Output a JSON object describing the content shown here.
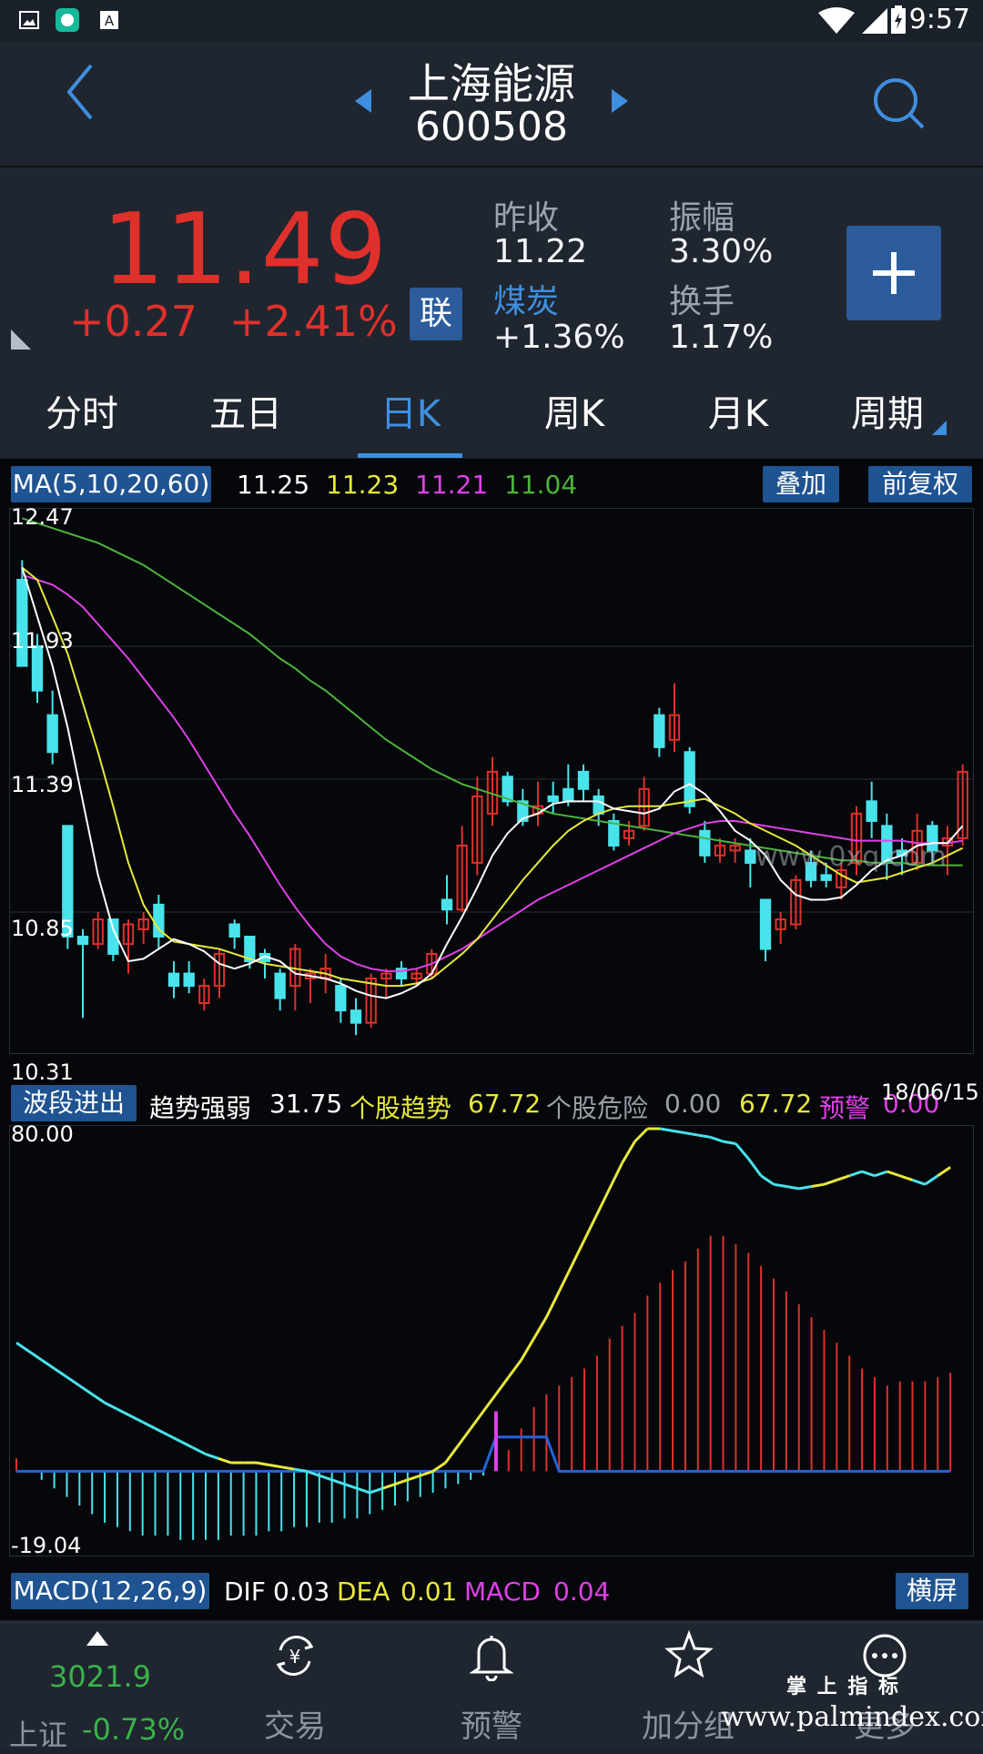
{
  "status_bar": {
    "time": "9:57"
  },
  "header": {
    "stock_name": "上海能源",
    "stock_code": "600508"
  },
  "quote": {
    "price": "11.49",
    "change": "+0.27",
    "change_pct": "+2.41%",
    "lian_label": "联",
    "prev_close_label": "昨收",
    "prev_close": "11.22",
    "amplitude_label": "振幅",
    "amplitude": "3.30%",
    "sector_label": "煤炭",
    "sector_change": "+1.36%",
    "turnover_label": "换手",
    "turnover": "1.17%"
  },
  "tabs": [
    {
      "label": "分时"
    },
    {
      "label": "五日"
    },
    {
      "label": "日K",
      "active": true
    },
    {
      "label": "周K"
    },
    {
      "label": "月K"
    },
    {
      "label": "周期"
    }
  ],
  "ma_bar": {
    "label": "MA(5,10,20,60)",
    "values": [
      "11.25",
      "11.23",
      "11.21",
      "11.04"
    ],
    "overlay_btn": "叠加",
    "adjust_btn": "前复权"
  },
  "kline": {
    "y_labels": [
      "12.47",
      "11.93",
      "11.39",
      "10.85",
      "10.31"
    ],
    "ymin": 10.31,
    "ymax": 12.47,
    "watermark": "www.0xq.com",
    "candles": [
      [
        12.2,
        12.28,
        11.85,
        11.85
      ],
      [
        11.93,
        11.98,
        11.7,
        11.75
      ],
      [
        11.65,
        11.75,
        11.45,
        11.5
      ],
      [
        11.2,
        11.2,
        10.7,
        10.75
      ],
      [
        10.75,
        10.78,
        10.42,
        10.72
      ],
      [
        10.72,
        10.85,
        10.7,
        10.82
      ],
      [
        10.82,
        10.82,
        10.65,
        10.68
      ],
      [
        10.72,
        10.82,
        10.6,
        10.8
      ],
      [
        10.78,
        10.85,
        10.72,
        10.82
      ],
      [
        10.88,
        10.92,
        10.7,
        10.75
      ],
      [
        10.6,
        10.65,
        10.5,
        10.55
      ],
      [
        10.6,
        10.65,
        10.52,
        10.55
      ],
      [
        10.48,
        10.58,
        10.45,
        10.55
      ],
      [
        10.55,
        10.7,
        10.5,
        10.68
      ],
      [
        10.8,
        10.82,
        10.7,
        10.75
      ],
      [
        10.75,
        10.75,
        10.62,
        10.65
      ],
      [
        10.68,
        10.7,
        10.58,
        10.65
      ],
      [
        10.6,
        10.62,
        10.45,
        10.5
      ],
      [
        10.55,
        10.72,
        10.45,
        10.7
      ],
      [
        10.58,
        10.62,
        10.48,
        10.6
      ],
      [
        10.58,
        10.68,
        10.52,
        10.62
      ],
      [
        10.55,
        10.58,
        10.4,
        10.45
      ],
      [
        10.45,
        10.5,
        10.35,
        10.4
      ],
      [
        10.4,
        10.6,
        10.38,
        10.58
      ],
      [
        10.58,
        10.62,
        10.5,
        10.6
      ],
      [
        10.62,
        10.65,
        10.55,
        10.58
      ],
      [
        10.58,
        10.62,
        10.55,
        10.6
      ],
      [
        10.6,
        10.7,
        10.58,
        10.68
      ],
      [
        10.9,
        11.0,
        10.8,
        10.86
      ],
      [
        10.86,
        11.2,
        10.85,
        11.12
      ],
      [
        11.05,
        11.4,
        11.0,
        11.32
      ],
      [
        11.25,
        11.48,
        11.2,
        11.42
      ],
      [
        11.4,
        11.42,
        11.28,
        11.3
      ],
      [
        11.3,
        11.35,
        11.2,
        11.22
      ],
      [
        11.25,
        11.38,
        11.2,
        11.28
      ],
      [
        11.32,
        11.38,
        11.25,
        11.3
      ],
      [
        11.35,
        11.45,
        11.28,
        11.3
      ],
      [
        11.42,
        11.45,
        11.3,
        11.35
      ],
      [
        11.32,
        11.35,
        11.2,
        11.25
      ],
      [
        11.22,
        11.25,
        11.1,
        11.12
      ],
      [
        11.15,
        11.22,
        11.12,
        11.18
      ],
      [
        11.2,
        11.4,
        11.18,
        11.35
      ],
      [
        11.65,
        11.68,
        11.48,
        11.52
      ],
      [
        11.55,
        11.78,
        11.5,
        11.65
      ],
      [
        11.5,
        11.52,
        11.25,
        11.28
      ],
      [
        11.18,
        11.22,
        11.05,
        11.08
      ],
      [
        11.08,
        11.15,
        11.05,
        11.12
      ],
      [
        11.1,
        11.15,
        11.05,
        11.12
      ],
      [
        11.1,
        11.15,
        10.95,
        11.05
      ],
      [
        10.9,
        10.9,
        10.65,
        10.7
      ],
      [
        10.78,
        10.85,
        10.72,
        10.82
      ],
      [
        10.8,
        11.0,
        10.78,
        10.98
      ],
      [
        11.05,
        11.1,
        10.95,
        10.98
      ],
      [
        11.0,
        11.05,
        10.95,
        10.98
      ],
      [
        10.95,
        11.05,
        10.9,
        11.02
      ],
      [
        11.05,
        11.28,
        11.0,
        11.25
      ],
      [
        11.3,
        11.38,
        11.15,
        11.22
      ],
      [
        11.2,
        11.25,
        10.98,
        11.05
      ],
      [
        11.1,
        11.15,
        11.0,
        11.08
      ],
      [
        11.05,
        11.25,
        11.02,
        11.18
      ],
      [
        11.2,
        11.22,
        11.05,
        11.1
      ],
      [
        11.12,
        11.2,
        11.0,
        11.15
      ],
      [
        11.15,
        11.45,
        11.12,
        11.42
      ]
    ],
    "ma5": [
      12.25,
      12.05,
      11.85,
      11.6,
      11.3,
      11.0,
      10.78,
      10.65,
      10.66,
      10.7,
      10.74,
      10.72,
      10.69,
      10.64,
      10.62,
      10.64,
      10.67,
      10.65,
      10.6,
      10.59,
      10.58,
      10.56,
      10.53,
      10.51,
      10.5,
      10.52,
      10.55,
      10.6,
      10.72,
      10.83,
      10.95,
      11.08,
      11.17,
      11.23,
      11.25,
      11.29,
      11.3,
      11.3,
      11.3,
      11.27,
      11.26,
      11.25,
      11.27,
      11.34,
      11.37,
      11.33,
      11.26,
      11.18,
      11.14,
      11.08,
      10.98,
      10.92,
      10.9,
      10.9,
      10.91,
      10.96,
      11.02,
      11.06,
      11.08,
      11.12,
      11.13,
      11.13,
      11.2
    ],
    "ma10": [
      12.25,
      12.2,
      12.05,
      11.9,
      11.7,
      11.5,
      11.28,
      11.05,
      10.88,
      10.78,
      10.73,
      10.72,
      10.71,
      10.7,
      10.68,
      10.66,
      10.64,
      10.63,
      10.62,
      10.61,
      10.6,
      10.58,
      10.57,
      10.56,
      10.55,
      10.55,
      10.56,
      10.58,
      10.63,
      10.68,
      10.74,
      10.82,
      10.9,
      10.98,
      11.05,
      11.12,
      11.18,
      11.22,
      11.25,
      11.27,
      11.28,
      11.28,
      11.28,
      11.29,
      11.3,
      11.31,
      11.28,
      11.25,
      11.21,
      11.18,
      11.15,
      11.12,
      11.08,
      11.04,
      11.0,
      10.97,
      10.98,
      10.99,
      11.01,
      11.03,
      11.05,
      11.08,
      11.11
    ],
    "ma20": [
      12.22,
      12.2,
      12.18,
      12.14,
      12.09,
      12.02,
      11.95,
      11.88,
      11.8,
      11.72,
      11.64,
      11.55,
      11.45,
      11.35,
      11.25,
      11.16,
      11.06,
      10.96,
      10.87,
      10.79,
      10.72,
      10.67,
      10.64,
      10.62,
      10.61,
      10.61,
      10.62,
      10.64,
      10.67,
      10.7,
      10.74,
      10.78,
      10.82,
      10.86,
      10.9,
      10.93,
      10.96,
      10.99,
      11.02,
      11.05,
      11.08,
      11.11,
      11.14,
      11.17,
      11.19,
      11.21,
      11.22,
      11.22,
      11.21,
      11.2,
      11.19,
      11.18,
      11.17,
      11.16,
      11.15,
      11.14,
      11.14,
      11.14,
      11.14,
      11.13,
      11.13,
      11.13,
      11.14
    ],
    "ma60": [
      12.45,
      12.43,
      12.41,
      12.39,
      12.37,
      12.35,
      12.32,
      12.29,
      12.26,
      12.22,
      12.18,
      12.14,
      12.1,
      12.06,
      12.02,
      11.98,
      11.93,
      11.88,
      11.84,
      11.79,
      11.75,
      11.7,
      11.65,
      11.6,
      11.55,
      11.51,
      11.47,
      11.43,
      11.4,
      11.37,
      11.35,
      11.33,
      11.31,
      11.29,
      11.27,
      11.25,
      11.24,
      11.23,
      11.22,
      11.21,
      11.2,
      11.19,
      11.18,
      11.17,
      11.16,
      11.15,
      11.14,
      11.13,
      11.12,
      11.11,
      11.1,
      11.09,
      11.08,
      11.07,
      11.06,
      11.06,
      11.05,
      11.05,
      11.05,
      11.04,
      11.04,
      11.04,
      11.04
    ],
    "ma_colors": [
      "#ffffff",
      "#e8e83a",
      "#e040e8",
      "#4db43b"
    ]
  },
  "indicator": {
    "btn_label": "波段进出",
    "trend_label": "趋势强弱",
    "trend_value": "31.75",
    "stock_trend_label": "个股趋势",
    "stock_trend_value": "67.72",
    "risk_label": "个股危险",
    "risk_value": "0.00",
    "extra_value": "67.72",
    "warn_label": "预警",
    "warn_value": "0.00",
    "date": "18/06/15",
    "y_top": "80.00",
    "y_bottom": "-19.04",
    "ymin": -19.04,
    "ymax": 80.0,
    "zero": 0,
    "line": [
      30,
      28,
      26,
      24,
      22,
      20,
      18,
      16,
      14.5,
      13,
      11.5,
      10,
      8.5,
      7,
      5.5,
      4,
      3,
      2,
      2,
      2,
      1.5,
      1,
      0.5,
      0,
      -1,
      -2,
      -3,
      -4,
      -5,
      -4,
      -3,
      -2,
      -1,
      0,
      2,
      6,
      10,
      14,
      18,
      22,
      26,
      31,
      36,
      42,
      48,
      54,
      60,
      66,
      72,
      77,
      80,
      80,
      79.5,
      79,
      78.5,
      78,
      77,
      76.5,
      73,
      69,
      67,
      66.5,
      66,
      66.5,
      67,
      68,
      69,
      70,
      69,
      70,
      69,
      68,
      67,
      69,
      71
    ],
    "line_cyan": [
      true,
      true,
      true,
      true,
      true,
      true,
      true,
      true,
      true,
      true,
      true,
      true,
      true,
      true,
      true,
      true,
      false,
      false,
      false,
      false,
      false,
      false,
      true,
      true,
      true,
      true,
      true,
      true,
      true,
      false,
      false,
      false,
      false,
      false,
      false,
      false,
      false,
      false,
      false,
      false,
      false,
      false,
      false,
      false,
      false,
      false,
      false,
      false,
      false,
      false,
      false,
      true,
      true,
      true,
      true,
      true,
      true,
      true,
      true,
      true,
      true,
      true,
      true,
      false,
      false,
      false,
      true,
      true,
      true,
      false,
      false,
      true,
      true,
      false,
      false
    ],
    "bars": [
      3,
      0,
      -2,
      -4,
      -6,
      -8,
      -10,
      -12,
      -13,
      -14,
      -15,
      -15,
      -15,
      -16,
      -16,
      -16,
      -16,
      -15,
      -15,
      -15,
      -14,
      -14,
      -13,
      -13,
      -12,
      -12,
      -11,
      -11,
      -10,
      -9,
      -8,
      -7,
      -6,
      -5,
      -4,
      -3,
      -2,
      -1,
      0,
      5,
      10,
      15,
      18,
      20,
      22,
      24,
      27,
      31,
      34,
      37,
      41,
      44,
      47,
      49,
      52,
      55,
      55,
      53,
      51,
      48,
      45,
      42,
      39,
      36,
      33,
      30,
      27,
      24,
      22,
      20,
      21,
      21,
      21,
      22,
      23
    ],
    "blue_line": [
      0,
      0,
      0,
      0,
      0,
      0,
      0,
      0,
      0,
      0,
      0,
      0,
      0,
      0,
      0,
      0,
      0,
      0,
      0,
      0,
      0,
      0,
      0,
      0,
      0,
      0,
      0,
      0,
      0,
      0,
      0,
      0,
      0,
      0,
      0,
      0,
      0,
      0,
      8,
      8,
      8,
      8,
      8,
      0,
      0,
      0,
      0,
      0,
      0,
      0,
      0,
      0,
      0,
      0,
      0,
      0,
      0,
      0,
      0,
      0,
      0,
      0,
      0,
      0,
      0,
      0,
      0,
      0,
      0,
      0,
      0,
      0,
      0,
      0,
      0
    ]
  },
  "macd_bar": {
    "label": "MACD(12,26,9)",
    "dif_label": "DIF",
    "dif_value": "0.03",
    "dea_label": "DEA",
    "dea_value": "0.01",
    "macd_label": "MACD",
    "macd_value": "0.04",
    "landscape_btn": "横屏"
  },
  "bottom_nav": {
    "index_value": "3021.9",
    "index_name": "上证",
    "index_change": "-0.73%",
    "items": [
      {
        "label": "交易",
        "icon": "yen-exchange-icon"
      },
      {
        "label": "预警",
        "icon": "bell-icon"
      },
      {
        "label": "加分组",
        "icon": "star-icon"
      },
      {
        "label": "更多",
        "icon": "more-dots-icon"
      }
    ],
    "watermark_top": "掌 上 指 标",
    "watermark_url": "www.palmindex.com"
  },
  "colors": {
    "up": "#e0302b",
    "down": "#49e3ec",
    "accent": "#3f8fe0",
    "button": "#1f5391"
  }
}
